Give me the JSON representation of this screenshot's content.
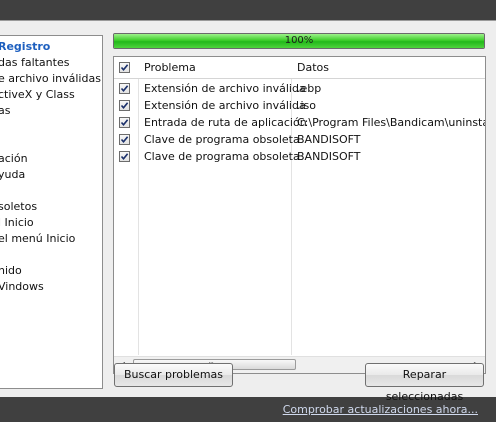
{
  "sidebar": {
    "items": [
      {
        "label": "Registro",
        "active": true
      },
      {
        "label": "das faltantes"
      },
      {
        "label": "e archivo inválidas"
      },
      {
        "label": "ctiveX y Class"
      },
      {
        "label": "as"
      },
      {
        "label": "ación"
      },
      {
        "label": "yuda"
      },
      {
        "label": "soletos"
      },
      {
        "label": "l Inicio"
      },
      {
        "label": "el menú Inicio"
      },
      {
        "label": "nido"
      },
      {
        "label": "Vindows"
      }
    ]
  },
  "progress": {
    "label": "100%",
    "value": 1.0
  },
  "table": {
    "columns": [
      "Problema",
      "Datos"
    ],
    "rows": [
      {
        "checked": true,
        "problema": "Extensión de archivo inválida",
        "datos": ".ebp"
      },
      {
        "checked": true,
        "problema": "Extensión de archivo inválida",
        "datos": ".iso"
      },
      {
        "checked": true,
        "problema": "Entrada de ruta de aplicación",
        "datos": "C:\\Program Files\\Bandicam\\uninstall.ex"
      },
      {
        "checked": true,
        "problema": "Clave de programa obsoleta",
        "datos": "BANDISOFT"
      },
      {
        "checked": true,
        "problema": "Clave de programa obsoleta",
        "datos": "BANDISOFT"
      }
    ],
    "header_checked": true
  },
  "scrollbar": {
    "left_icon": "left-arrow-icon",
    "right_icon": "right-arrow-icon",
    "grip": "|||"
  },
  "buttons": {
    "scan": "Buscar problemas",
    "fix": "Reparar seleccionadas"
  },
  "footer": {
    "update_link": "Comprobar actualizaciones ahora..."
  },
  "colors": {
    "accent": "#1d5fbf",
    "progress": "#3fce2b"
  }
}
